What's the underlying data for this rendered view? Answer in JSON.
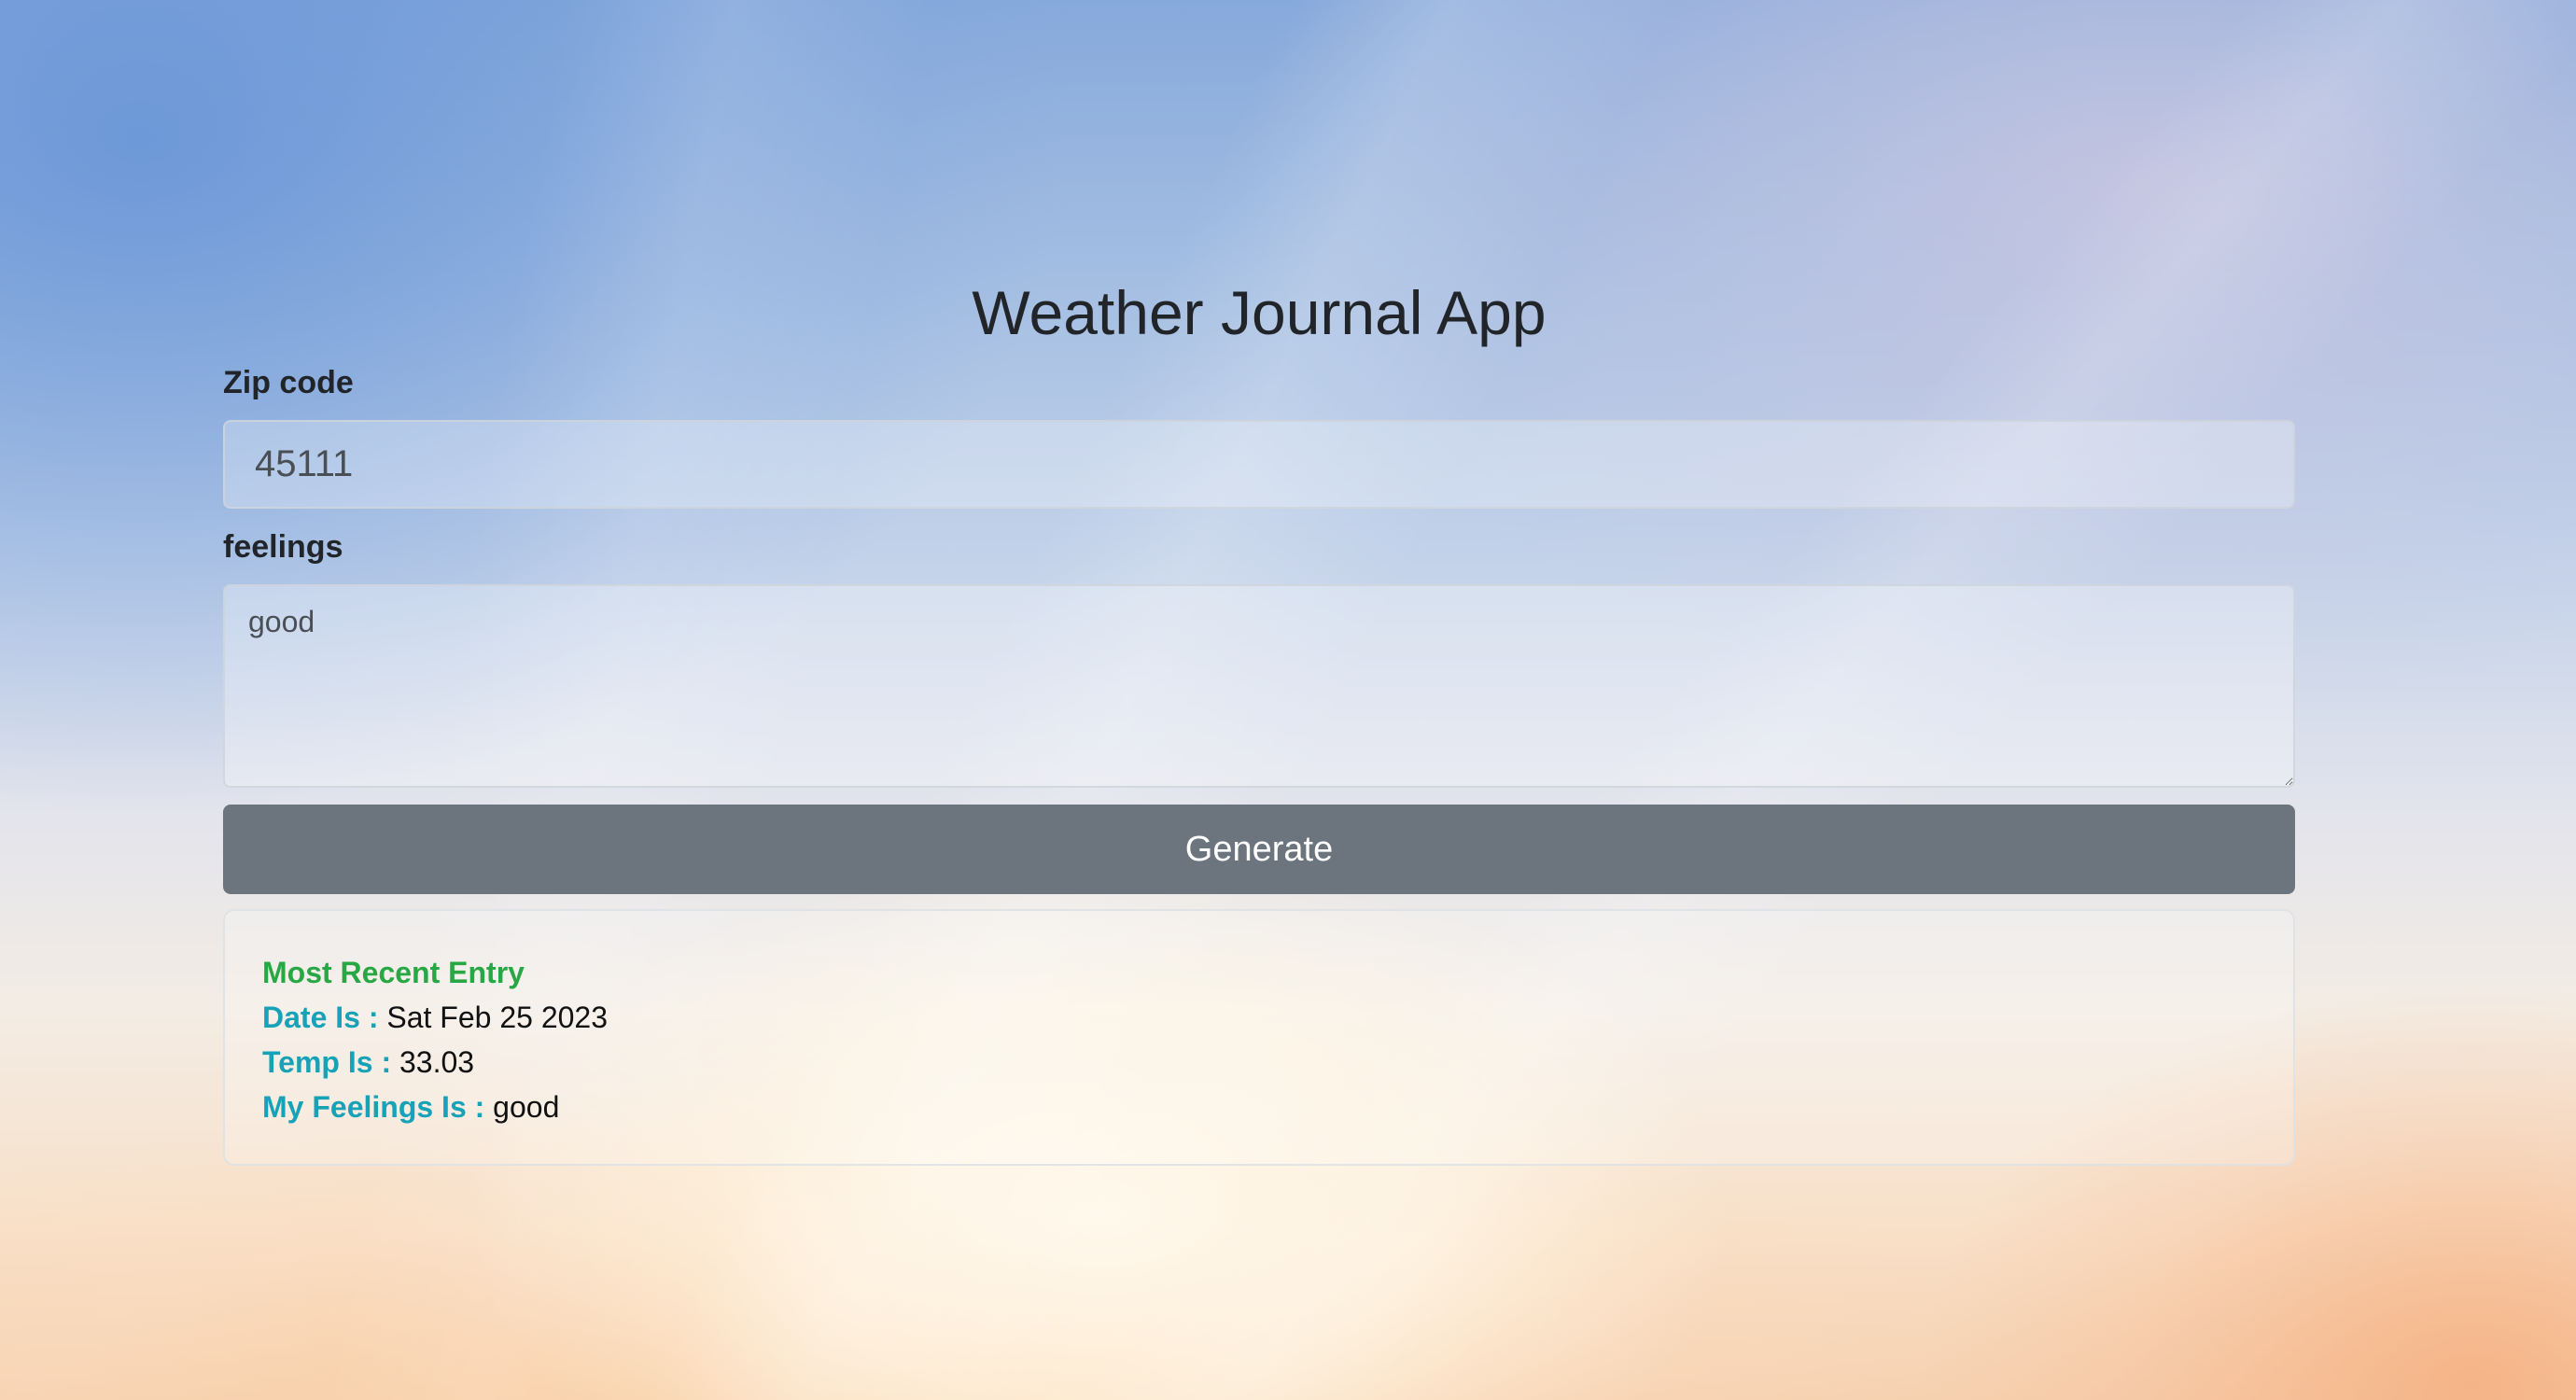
{
  "app": {
    "title": "Weather Journal App"
  },
  "form": {
    "zip_label": "Zip code",
    "zip_value": "45111",
    "feelings_label": "feelings",
    "feelings_value": "good",
    "generate_label": "Generate"
  },
  "entry": {
    "heading": "Most Recent Entry",
    "date_label": "Date Is :",
    "date_value": "Sat Feb 25 2023",
    "temp_label": "Temp Is :",
    "temp_value": "33.03",
    "feelings_label": "My Feelings Is :",
    "feelings_value": "good"
  },
  "colors": {
    "button_bg": "#6c757d",
    "heading_green": "#28a745",
    "key_teal": "#17a2b8",
    "text_dark": "#212529"
  }
}
